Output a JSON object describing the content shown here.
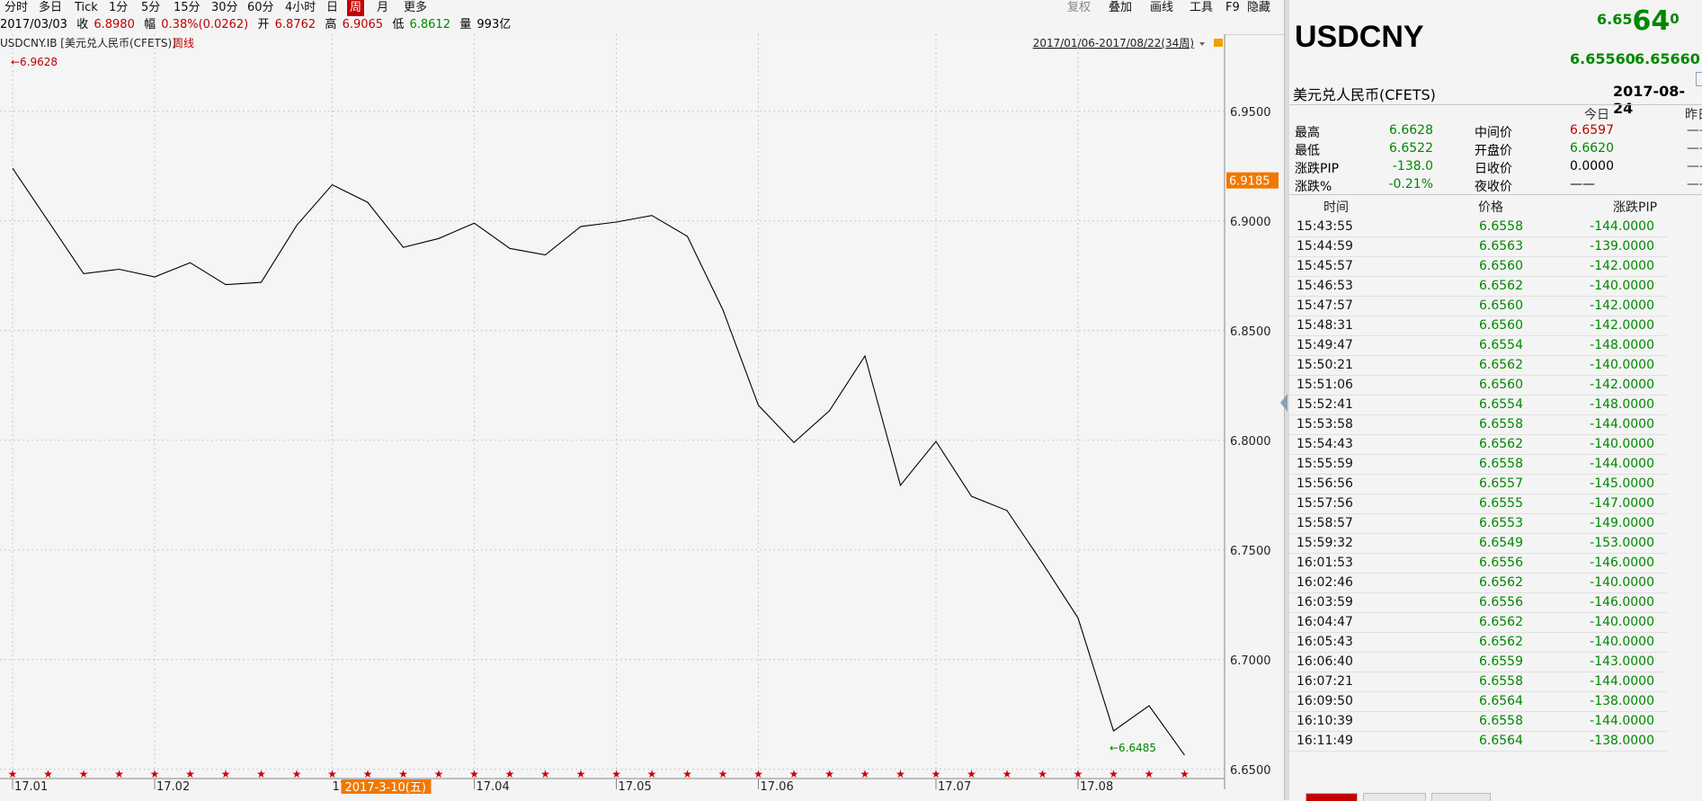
{
  "toolbar": {
    "items": [
      "分时",
      "多日",
      "Tick",
      "1分",
      "5分",
      "15分",
      "30分",
      "60分",
      "4小时",
      "日",
      "周",
      "月",
      "更多"
    ],
    "active": "周",
    "right_items": [
      "复权",
      "叠加",
      "画线",
      "工具",
      "F9",
      "隐藏"
    ]
  },
  "quote_row": {
    "date": "2017/03/03",
    "close_label": "收",
    "close": "6.8980",
    "change_label": "幅",
    "change": "0.38%(0.0262)",
    "open_label": "开",
    "open": "6.8762",
    "high_label": "高",
    "high": "6.9065",
    "low_label": "低",
    "low": "6.8612",
    "volume_label": "量",
    "volume": "993亿"
  },
  "chart_header": {
    "symbol": "USDCNY.IB",
    "name": "[美元兑人民币(CFETS)]",
    "period": "周线",
    "range": "2017/01/06-2017/08/22(34周)"
  },
  "chart_data": {
    "type": "line",
    "title": "",
    "x": [
      "2017-01-06",
      "2017-01-13",
      "2017-01-20",
      "2017-01-27",
      "2017-02-03",
      "2017-02-10",
      "2017-02-17",
      "2017-02-24",
      "2017-03-03",
      "2017-03-10",
      "2017-03-17",
      "2017-03-24",
      "2017-03-31",
      "2017-04-07",
      "2017-04-14",
      "2017-04-21",
      "2017-04-28",
      "2017-05-05",
      "2017-05-12",
      "2017-05-19",
      "2017-05-26",
      "2017-06-02",
      "2017-06-09",
      "2017-06-16",
      "2017-06-23",
      "2017-06-30",
      "2017-07-07",
      "2017-07-14",
      "2017-07-21",
      "2017-07-28",
      "2017-08-04",
      "2017-08-11",
      "2017-08-18",
      "2017-08-22"
    ],
    "series": [
      {
        "values": [
          6.924,
          6.9,
          6.876,
          6.878,
          6.8745,
          6.881,
          6.871,
          6.872,
          6.898,
          6.9165,
          6.9085,
          6.888,
          6.892,
          6.899,
          6.8875,
          6.8845,
          6.8975,
          6.8995,
          6.9025,
          6.893,
          6.8595,
          6.816,
          6.799,
          6.8135,
          6.8385,
          6.7795,
          6.7995,
          6.7745,
          6.768,
          6.744,
          6.719,
          6.6675,
          6.679,
          6.6565
        ]
      }
    ],
    "yticks": [
      "6.9500",
      "6.9000",
      "6.8500",
      "6.8000",
      "6.7500",
      "6.7000",
      "6.6500"
    ],
    "ylim": [
      6.645,
      6.962
    ],
    "xticks": [
      {
        "label": "17.01",
        "index": 0
      },
      {
        "label": "17.02",
        "index": 4
      },
      {
        "label": "17.04",
        "index": 13
      },
      {
        "label": "17.05",
        "index": 17
      },
      {
        "label": "17.06",
        "index": 21
      },
      {
        "label": "17.07",
        "index": 26
      },
      {
        "label": "17.08",
        "index": 30
      }
    ],
    "max_label": "6.9628",
    "min_label": "6.6485",
    "current_price_label": "6.9185",
    "current_price": 6.9185,
    "cursor_label": "17",
    "cursor_date": "2017-3-10(五)",
    "cursor_index": 9,
    "grid": true,
    "line_color": "#000000",
    "marker_color": "#cc0000"
  },
  "panel": {
    "symbol": "USDCNY",
    "big_price_a": "6.65",
    "big_price_b": "64",
    "big_price_c": "0",
    "bid": "6.65560",
    "ask": "6.65660",
    "name": "美元兑人民币(CFETS)",
    "date": "2017-08-24",
    "col_today": "今日",
    "col_yesterday": "昨日",
    "stats_left": [
      {
        "label": "最高",
        "value": "6.6628"
      },
      {
        "label": "最低",
        "value": "6.6522"
      },
      {
        "label": "涨跌PIP",
        "value": "-138.0"
      },
      {
        "label": "涨跌%",
        "value": "-0.21%"
      }
    ],
    "stats_right": [
      {
        "label": "中间价",
        "value": "6.6597",
        "color": "red"
      },
      {
        "label": "开盘价",
        "value": "6.6620",
        "color": "green"
      },
      {
        "label": "日收价",
        "value": "0.0000",
        "color": "black"
      },
      {
        "label": "夜收价",
        "value": "——",
        "color": "black"
      }
    ],
    "yesterday_values": [
      "——",
      "——",
      "——",
      "——"
    ],
    "table_headers": [
      "时间",
      "价格",
      "涨跌PIP"
    ],
    "ticks": [
      {
        "time": "15:43:55",
        "price": "6.6558",
        "change": "-144.0000"
      },
      {
        "time": "15:44:59",
        "price": "6.6563",
        "change": "-139.0000"
      },
      {
        "time": "15:45:57",
        "price": "6.6560",
        "change": "-142.0000"
      },
      {
        "time": "15:46:53",
        "price": "6.6562",
        "change": "-140.0000"
      },
      {
        "time": "15:47:57",
        "price": "6.6560",
        "change": "-142.0000"
      },
      {
        "time": "15:48:31",
        "price": "6.6560",
        "change": "-142.0000"
      },
      {
        "time": "15:49:47",
        "price": "6.6554",
        "change": "-148.0000"
      },
      {
        "time": "15:50:21",
        "price": "6.6562",
        "change": "-140.0000"
      },
      {
        "time": "15:51:06",
        "price": "6.6560",
        "change": "-142.0000"
      },
      {
        "time": "15:52:41",
        "price": "6.6554",
        "change": "-148.0000"
      },
      {
        "time": "15:53:58",
        "price": "6.6558",
        "change": "-144.0000"
      },
      {
        "time": "15:54:43",
        "price": "6.6562",
        "change": "-140.0000"
      },
      {
        "time": "15:55:59",
        "price": "6.6558",
        "change": "-144.0000"
      },
      {
        "time": "15:56:56",
        "price": "6.6557",
        "change": "-145.0000"
      },
      {
        "time": "15:57:56",
        "price": "6.6555",
        "change": "-147.0000"
      },
      {
        "time": "15:58:57",
        "price": "6.6553",
        "change": "-149.0000"
      },
      {
        "time": "15:59:32",
        "price": "6.6549",
        "change": "-153.0000"
      },
      {
        "time": "16:01:53",
        "price": "6.6556",
        "change": "-146.0000"
      },
      {
        "time": "16:02:46",
        "price": "6.6562",
        "change": "-140.0000"
      },
      {
        "time": "16:03:59",
        "price": "6.6556",
        "change": "-146.0000"
      },
      {
        "time": "16:04:47",
        "price": "6.6562",
        "change": "-140.0000"
      },
      {
        "time": "16:05:43",
        "price": "6.6562",
        "change": "-140.0000"
      },
      {
        "time": "16:06:40",
        "price": "6.6559",
        "change": "-143.0000"
      },
      {
        "time": "16:07:21",
        "price": "6.6558",
        "change": "-144.0000"
      },
      {
        "time": "16:09:50",
        "price": "6.6564",
        "change": "-138.0000"
      },
      {
        "time": "16:10:39",
        "price": "6.6558",
        "change": "-144.0000"
      },
      {
        "time": "16:11:49",
        "price": "6.6564",
        "change": "-138.0000"
      }
    ]
  }
}
